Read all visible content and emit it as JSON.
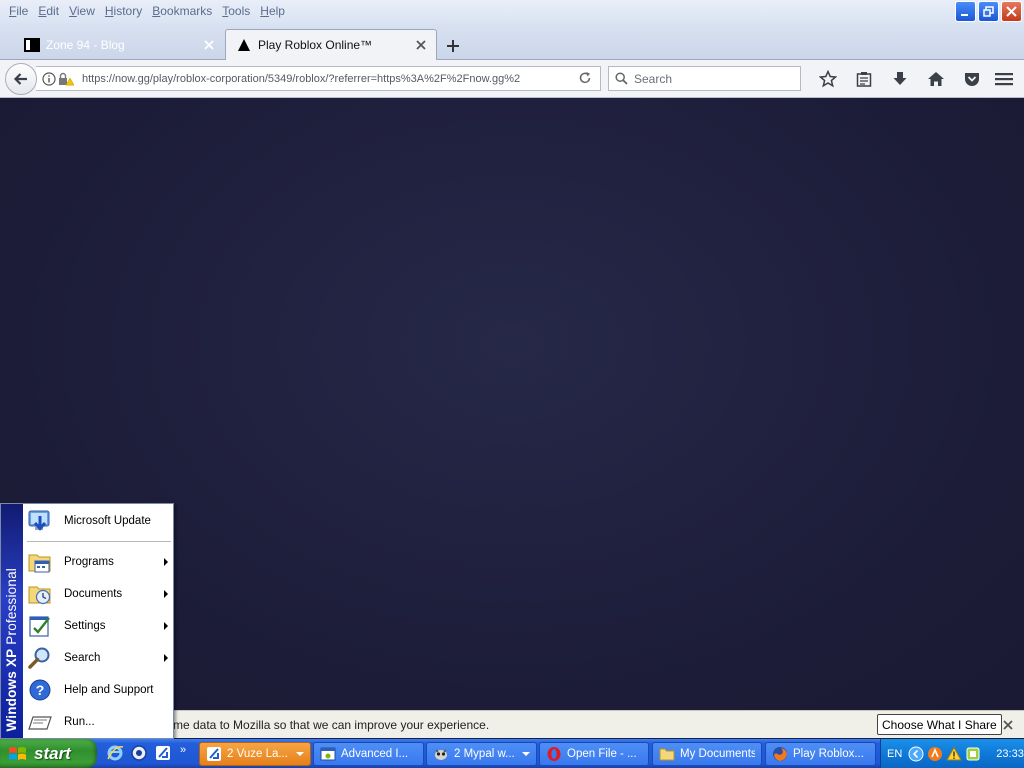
{
  "browser": {
    "menu": [
      {
        "accel": "F",
        "rest": "ile"
      },
      {
        "accel": "E",
        "rest": "dit"
      },
      {
        "accel": "V",
        "rest": "iew"
      },
      {
        "accel": "H",
        "rest": "istory"
      },
      {
        "accel": "B",
        "rest": "ookmarks"
      },
      {
        "accel": "T",
        "rest": "ools"
      },
      {
        "accel": "H",
        "rest": "elp"
      }
    ],
    "tabs": [
      {
        "title": "Zone 94 - Blog",
        "active": false
      },
      {
        "title": "Play Roblox Online™",
        "active": true
      }
    ],
    "url": "https://now.gg/play/roblox-corporation/5349/roblox/?referrer=https%3A%2F%2Fnow.gg%2",
    "search_placeholder": "Search"
  },
  "notification": {
    "text": "me data to Mozilla so that we can improve your experience.",
    "button_label": "Choose What I Share"
  },
  "start_menu": {
    "band_bold": "Windows XP",
    "band_light": "Professional",
    "items": [
      {
        "label": "Microsoft Update",
        "icon": "windows-update-icon",
        "submenu": false
      },
      {
        "label": "Programs",
        "icon": "programs-icon",
        "submenu": true
      },
      {
        "label": "Documents",
        "icon": "documents-icon",
        "submenu": true
      },
      {
        "label": "Settings",
        "icon": "settings-icon",
        "submenu": true
      },
      {
        "label": "Search",
        "icon": "search-icon",
        "submenu": true
      },
      {
        "label": "Help and Support",
        "icon": "help-icon",
        "submenu": false
      },
      {
        "label": "Run...",
        "icon": "run-icon",
        "submenu": false
      }
    ]
  },
  "taskbar": {
    "start_label": "start",
    "quicklaunch_more": "»",
    "buttons": [
      {
        "label": "2 Vuze La...",
        "icon": "vuze-icon",
        "highlighted": true,
        "dropdown": true
      },
      {
        "label": "Advanced I...",
        "icon": "app-window-icon",
        "highlighted": false,
        "dropdown": false
      },
      {
        "label": "2 Mypal w...",
        "icon": "mypal-icon",
        "highlighted": false,
        "dropdown": true
      },
      {
        "label": "Open File - ...",
        "icon": "opera-icon",
        "highlighted": false,
        "dropdown": false
      },
      {
        "label": "My Documents",
        "icon": "folder-icon",
        "highlighted": false,
        "dropdown": false
      },
      {
        "label": "Play Roblox...",
        "icon": "firefox-icon",
        "highlighted": false,
        "dropdown": false
      }
    ],
    "tray": {
      "language": "EN",
      "clock": "23:33"
    }
  },
  "colors": {
    "content_bg": "#1e1e3a",
    "taskbar_blue": "#245edb",
    "start_green": "#3c9e37",
    "highlight_orange": "#e6801a"
  }
}
